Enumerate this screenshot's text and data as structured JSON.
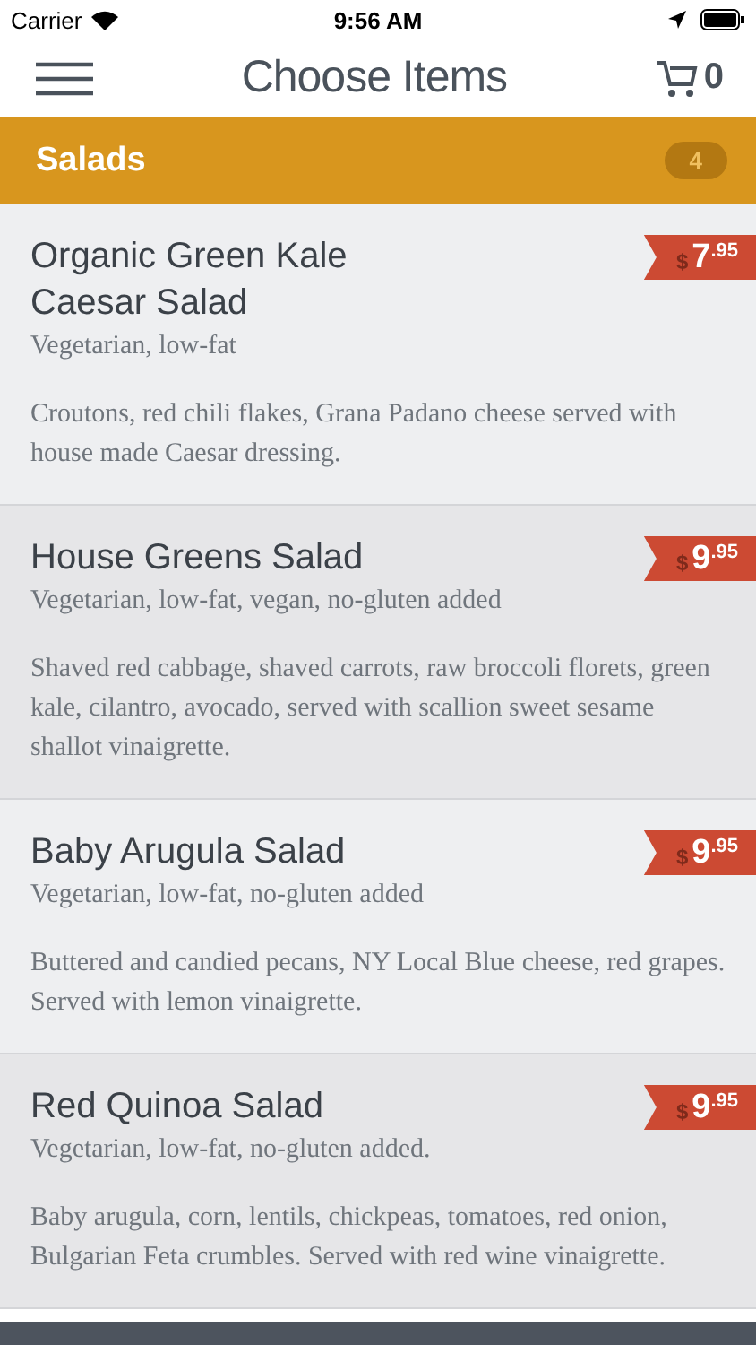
{
  "status_bar": {
    "carrier": "Carrier",
    "time": "9:56 AM"
  },
  "nav": {
    "title": "Choose Items",
    "cart_count": "0"
  },
  "section": {
    "title": "Salads",
    "count": "4"
  },
  "items": [
    {
      "name": "Organic Green Kale Caesar Salad",
      "tags": "Vegetarian, low-fat",
      "description": "Croutons, red chili flakes, Grana Padano cheese served with house made Caesar dressing.",
      "price": {
        "currency": "$",
        "amount": "7",
        "cents": ".95"
      }
    },
    {
      "name": "House Greens Salad",
      "tags": "Vegetarian, low-fat, vegan, no-gluten added",
      "description": "Shaved red cabbage, shaved carrots, raw broccoli florets, green kale, cilantro, avocado, served with scallion sweet sesame shallot vinaigrette.",
      "price": {
        "currency": "$",
        "amount": "9",
        "cents": ".95"
      }
    },
    {
      "name": "Baby Arugula Salad",
      "tags": "Vegetarian, low-fat, no-gluten added",
      "description": "Buttered and candied pecans, NY Local Blue cheese, red grapes. Served with lemon vinaigrette.",
      "price": {
        "currency": "$",
        "amount": "9",
        "cents": ".95"
      }
    },
    {
      "name": "Red Quinoa Salad",
      "tags": "Vegetarian, low-fat, no-gluten added.",
      "description": "Baby arugula, corn, lentils, chickpeas, tomatoes, red onion, Bulgarian Feta crumbles. Served with red wine vinaigrette.",
      "price": {
        "currency": "$",
        "amount": "9",
        "cents": ".95"
      }
    }
  ]
}
